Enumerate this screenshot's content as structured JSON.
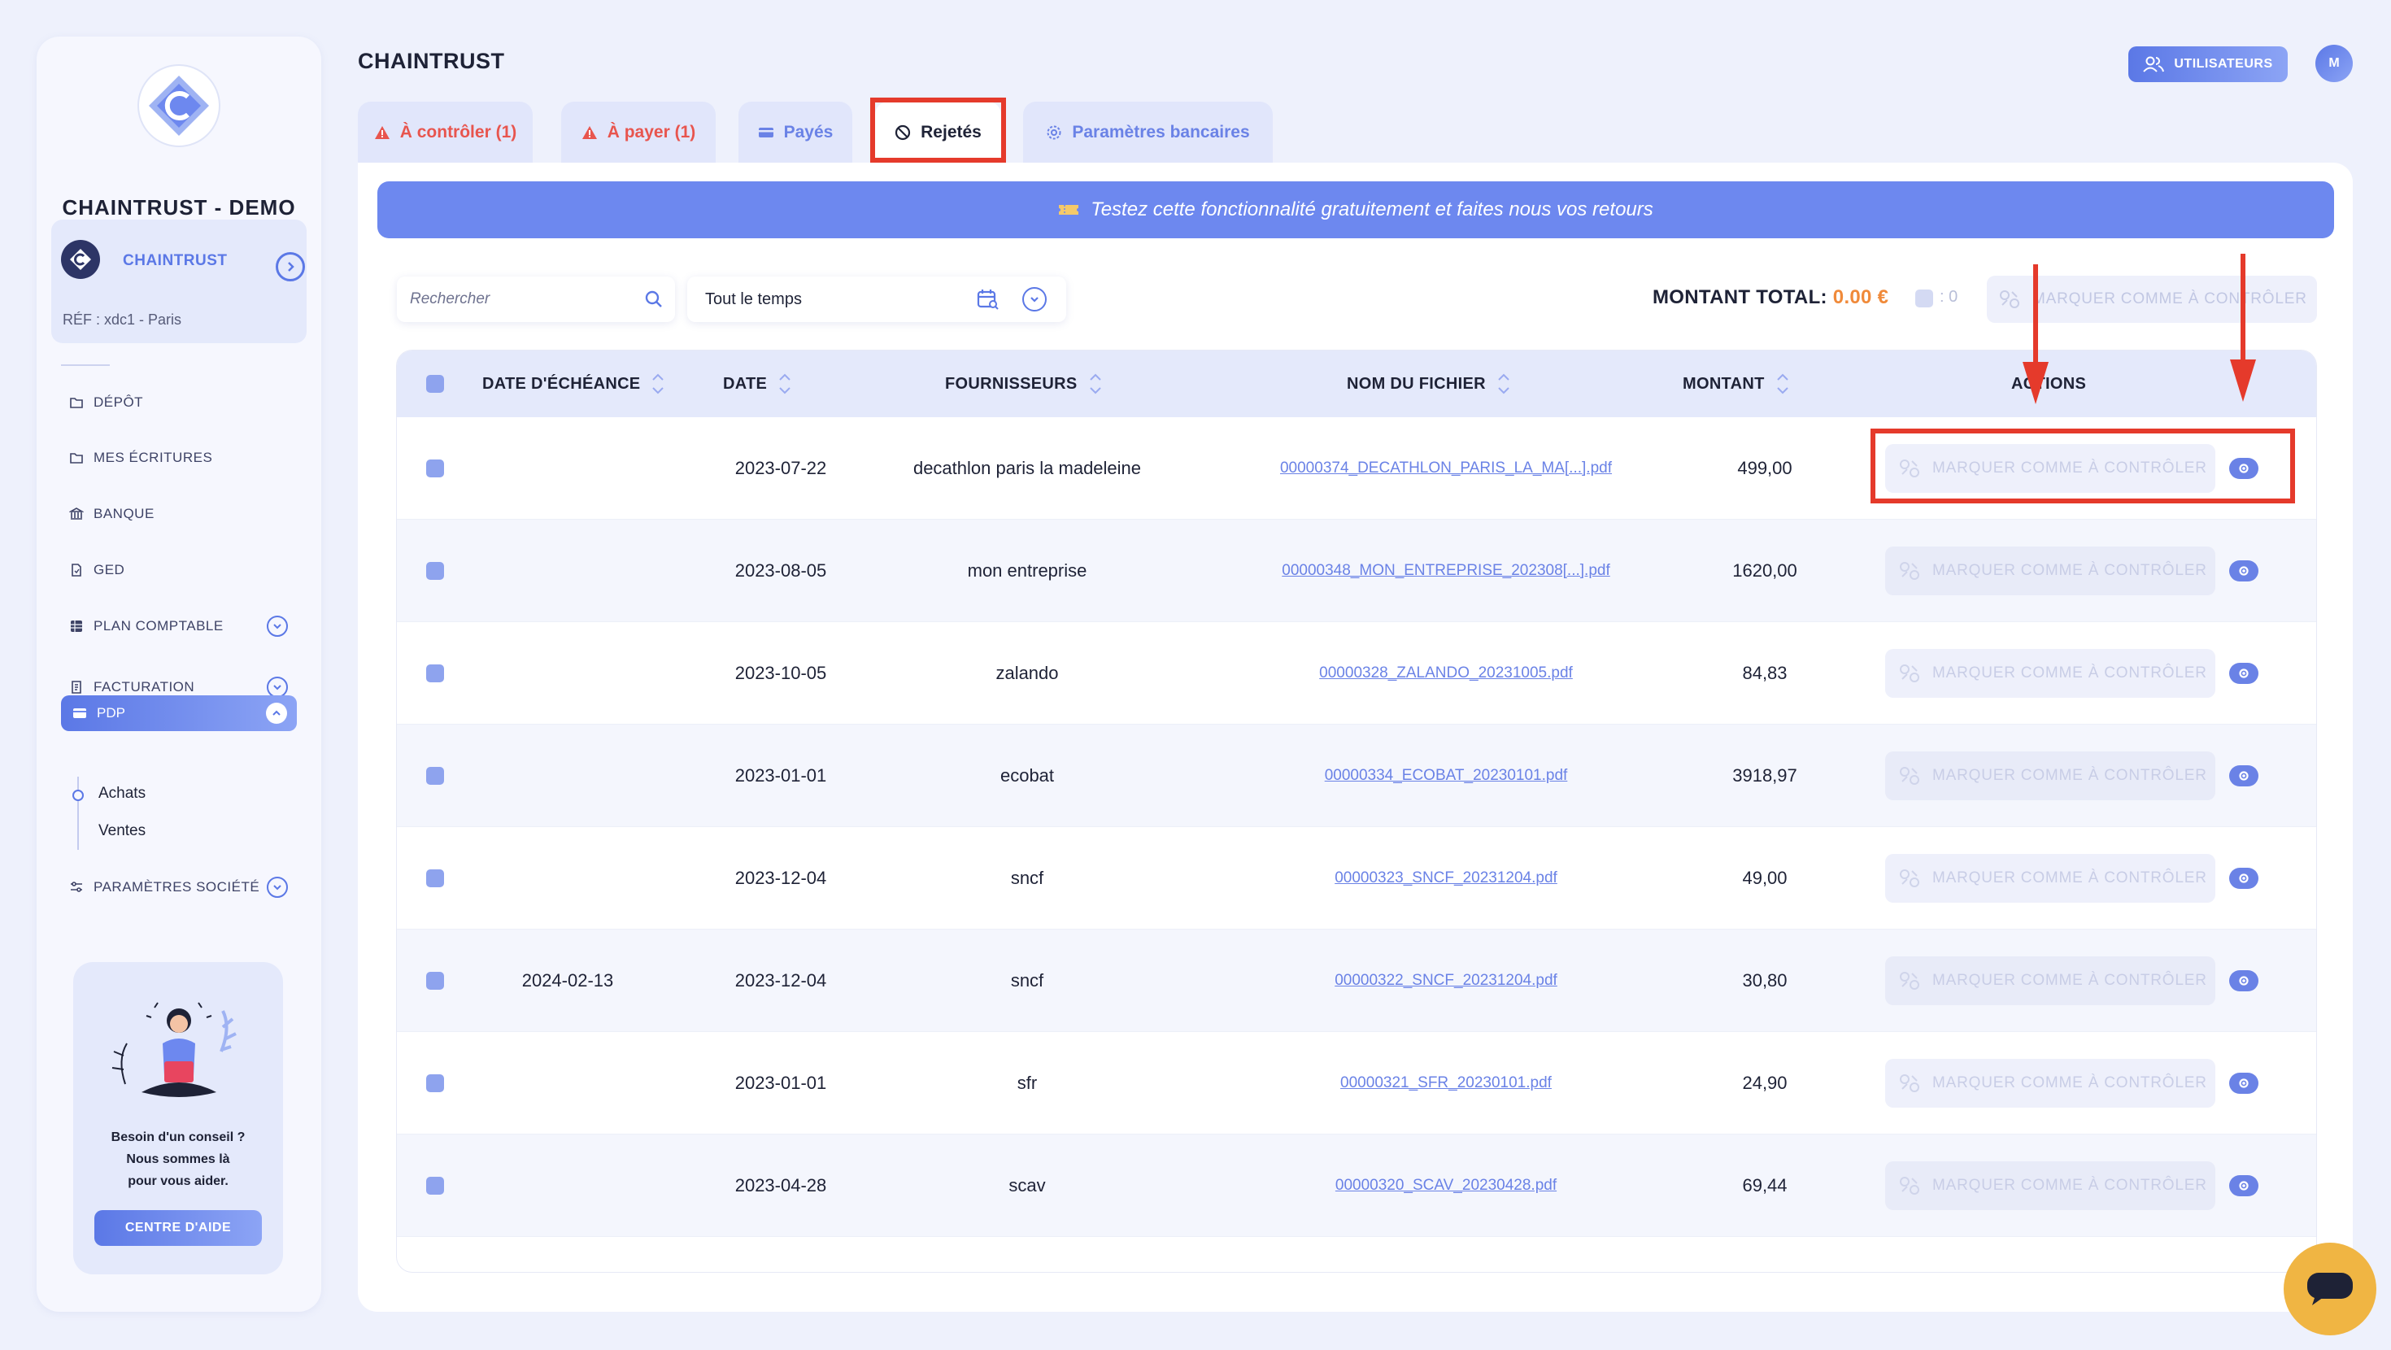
{
  "sidebar": {
    "company_title": "CHAINTRUST - DEMO",
    "company_card": {
      "name": "CHAINTRUST",
      "ref": "RÉF : xdc1 - Paris"
    },
    "nav": [
      {
        "label": "DÉPÔT",
        "icon": "folder-icon"
      },
      {
        "label": "MES ÉCRITURES",
        "icon": "folder-icon"
      },
      {
        "label": "BANQUE",
        "icon": "bank-icon"
      },
      {
        "label": "GED",
        "icon": "document-icon"
      },
      {
        "label": "PLAN COMPTABLE",
        "icon": "table-icon",
        "expandable": true
      },
      {
        "label": "FACTURATION",
        "icon": "invoice-icon",
        "expandable": true
      },
      {
        "label": "PDP",
        "icon": "card-icon",
        "active": true
      },
      {
        "label": "PARAMÈTRES SOCIÉTÉ",
        "icon": "sliders-icon",
        "expandable": true
      }
    ],
    "subnav": [
      {
        "label": "Achats",
        "active": true
      },
      {
        "label": "Ventes"
      }
    ],
    "help": {
      "line1": "Besoin d'un conseil ?",
      "line2": "Nous sommes là",
      "line3": "pour vous aider.",
      "button": "CENTRE D'AIDE"
    }
  },
  "header": {
    "title": "CHAINTRUST",
    "users_button": "UTILISATEURS",
    "avatar_initial": "M"
  },
  "tabs": [
    {
      "label": "À contrôler (1)",
      "icon": "warning-icon",
      "tone": "red"
    },
    {
      "label": "À payer (1)",
      "icon": "warning-icon",
      "tone": "red"
    },
    {
      "label": "Payés",
      "icon": "card-icon",
      "tone": "blue"
    },
    {
      "label": "Rejetés",
      "icon": "ban-icon",
      "tone": "active"
    },
    {
      "label": "Paramètres bancaires",
      "icon": "gear-icon",
      "tone": "blue"
    }
  ],
  "banner": {
    "text": "Testez cette fonctionnalité gratuitement et faites nous vos retours",
    "icon": "ticket-icon"
  },
  "filters": {
    "search_placeholder": "Rechercher",
    "period": "Tout le temps"
  },
  "summary": {
    "total_label": "MONTANT TOTAL:",
    "total_value": "0.00 €",
    "selected_count": ": 0",
    "bulk_action": "MARQUER COMME À CONTRÔLER"
  },
  "table": {
    "columns": [
      "DATE D'ÉCHÉANCE",
      "DATE",
      "FOURNISSEURS",
      "NOM DU FICHIER",
      "MONTANT",
      "ACTIONS"
    ],
    "action_label": "MARQUER COMME À CONTRÔLER",
    "rows": [
      {
        "due": "",
        "date": "2023-07-22",
        "supplier": "decathlon paris la madeleine",
        "file": "00000374_DECATHLON_PARIS_LA_MA[...].pdf",
        "amount": "499,00"
      },
      {
        "due": "",
        "date": "2023-08-05",
        "supplier": "mon entreprise",
        "file": "00000348_MON_ENTREPRISE_202308[...].pdf",
        "amount": "1620,00"
      },
      {
        "due": "",
        "date": "2023-10-05",
        "supplier": "zalando",
        "file": "00000328_ZALANDO_20231005.pdf",
        "amount": "84,83"
      },
      {
        "due": "",
        "date": "2023-01-01",
        "supplier": "ecobat",
        "file": "00000334_ECOBAT_20230101.pdf",
        "amount": "3918,97"
      },
      {
        "due": "",
        "date": "2023-12-04",
        "supplier": "sncf",
        "file": "00000323_SNCF_20231204.pdf",
        "amount": "49,00"
      },
      {
        "due": "2024-02-13",
        "date": "2023-12-04",
        "supplier": "sncf",
        "file": "00000322_SNCF_20231204.pdf",
        "amount": "30,80"
      },
      {
        "due": "",
        "date": "2023-01-01",
        "supplier": "sfr",
        "file": "00000321_SFR_20230101.pdf",
        "amount": "24,90"
      },
      {
        "due": "",
        "date": "2023-04-28",
        "supplier": "scav",
        "file": "00000320_SCAV_20230428.pdf",
        "amount": "69,44"
      }
    ]
  },
  "colors": {
    "accent": "#5b78e6",
    "warning": "#e8554e",
    "total": "#f08a3a",
    "annotation": "#e53a2b",
    "chat": "#f0b543"
  }
}
